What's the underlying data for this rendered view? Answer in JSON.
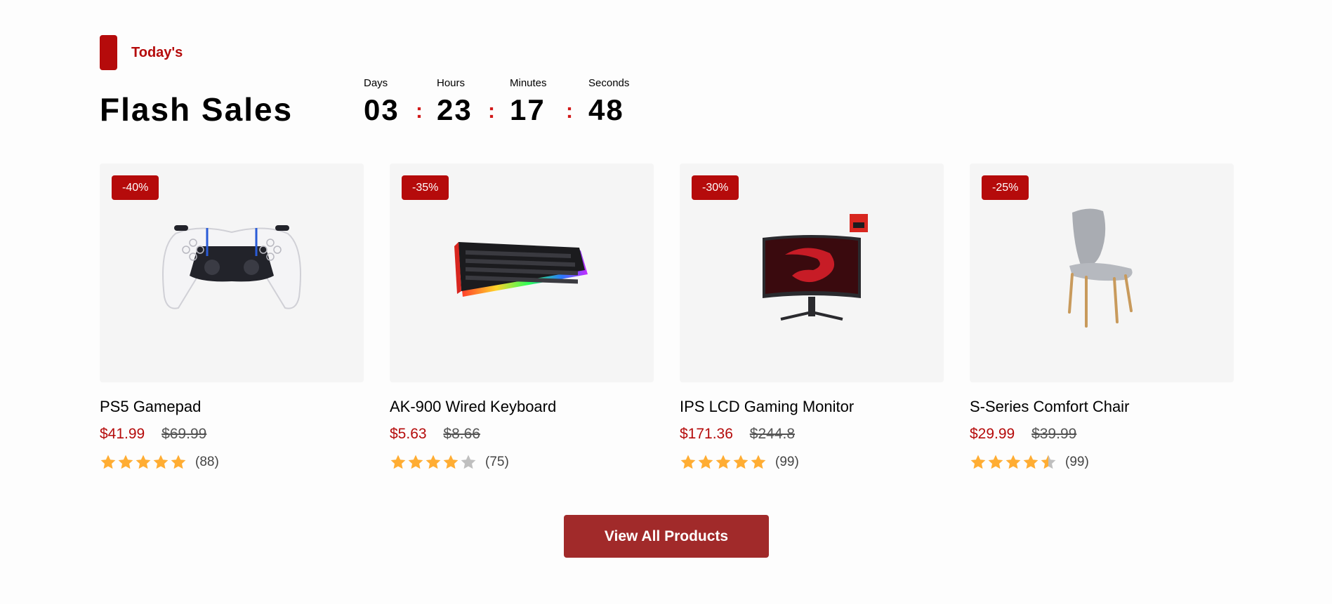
{
  "section": {
    "tag": "Today's",
    "title": "Flash Sales"
  },
  "countdown": [
    {
      "label": "Days",
      "value": "03"
    },
    {
      "label": "Hours",
      "value": "23"
    },
    {
      "label": "Minutes",
      "value": "17"
    },
    {
      "label": "Seconds",
      "value": "48"
    }
  ],
  "colon": ":",
  "colors": {
    "accent": "#b50b0b",
    "button": "#a12a2a",
    "star": "#ffad33",
    "star_empty": "#bfbfbf",
    "card_bg": "#f5f5f5"
  },
  "products": [
    {
      "discount": "-40%",
      "name": "PS5 Gamepad",
      "price": "$41.99",
      "old_price": "$69.99",
      "rating": 5,
      "reviews": "(88)",
      "icon": "gamepad-image"
    },
    {
      "discount": "-35%",
      "name": "AK-900 Wired Keyboard",
      "price": "$5.63",
      "old_price": "$8.66",
      "rating": 4,
      "reviews": "(75)",
      "icon": "keyboard-image"
    },
    {
      "discount": "-30%",
      "name": "IPS LCD Gaming Monitor",
      "price": "$171.36",
      "old_price": "$244.8",
      "rating": 5,
      "reviews": "(99)",
      "icon": "monitor-image"
    },
    {
      "discount": "-25%",
      "name": "S-Series Comfort Chair",
      "price": "$29.99",
      "old_price": "$39.99",
      "rating": 4.5,
      "reviews": "(99)",
      "icon": "chair-image"
    }
  ],
  "button": {
    "label": "View All Products"
  }
}
